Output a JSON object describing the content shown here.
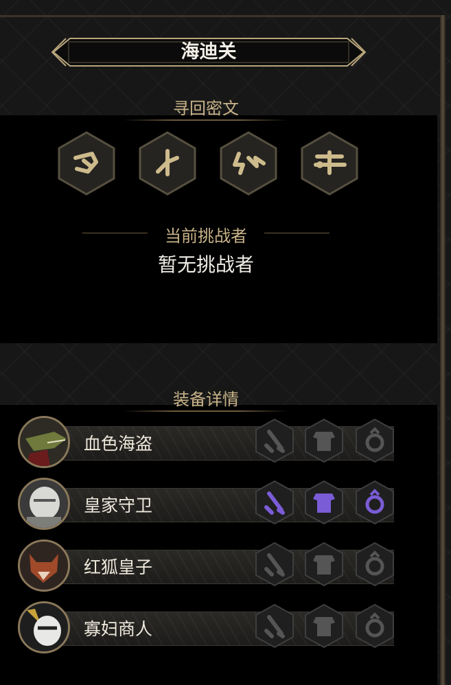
{
  "title": "海迪关",
  "sections": {
    "runes_title": "寻回密文",
    "challenger_label": "当前挑战者",
    "challenger_value": "暂无挑战者",
    "equipment_title": "装备详情"
  },
  "runes": [
    {
      "icon": "rune-glyph-1-icon"
    },
    {
      "icon": "rune-glyph-2-icon"
    },
    {
      "icon": "rune-glyph-3-icon"
    },
    {
      "icon": "rune-glyph-4-icon"
    }
  ],
  "heroes": [
    {
      "name": "血色海盗",
      "avatar": "crocodile-pirate-avatar",
      "equipped": false
    },
    {
      "name": "皇家守卫",
      "avatar": "royal-guard-avatar",
      "equipped": true
    },
    {
      "name": "红狐皇子",
      "avatar": "red-fox-prince-avatar",
      "equipped": false
    },
    {
      "name": "寡妇商人",
      "avatar": "widow-merchant-avatar",
      "equipped": false
    }
  ],
  "equipment_slots": [
    "sword-icon",
    "armor-icon",
    "ring-icon"
  ],
  "colors": {
    "gold": "#c9b48a",
    "equipped_purple": "#7a5cd6",
    "empty_slot": "#555555"
  }
}
